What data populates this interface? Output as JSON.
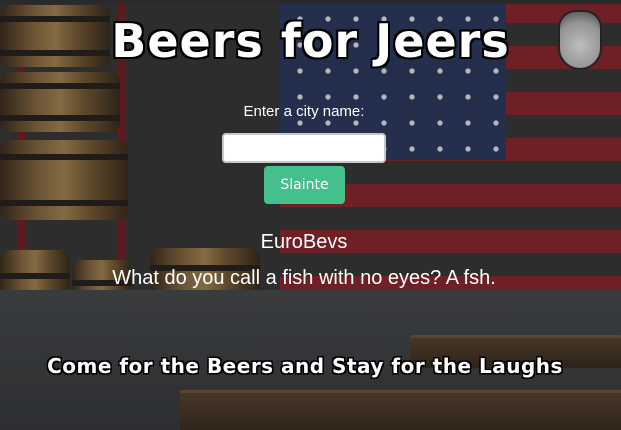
{
  "page": {
    "title": "Beers for Jeers",
    "input_label": "Enter a city name:",
    "city_input": {
      "value": "",
      "placeholder": ""
    },
    "submit_label": "Slainte",
    "result": {
      "company": "EuroBevs",
      "joke": "What do you call a fish with no eyes? A fsh."
    },
    "tagline": "Come for the Beers and Stay for the Laughs"
  },
  "colors": {
    "button": "#45bf8c",
    "text": "#ffffff",
    "outline": "#000000"
  }
}
